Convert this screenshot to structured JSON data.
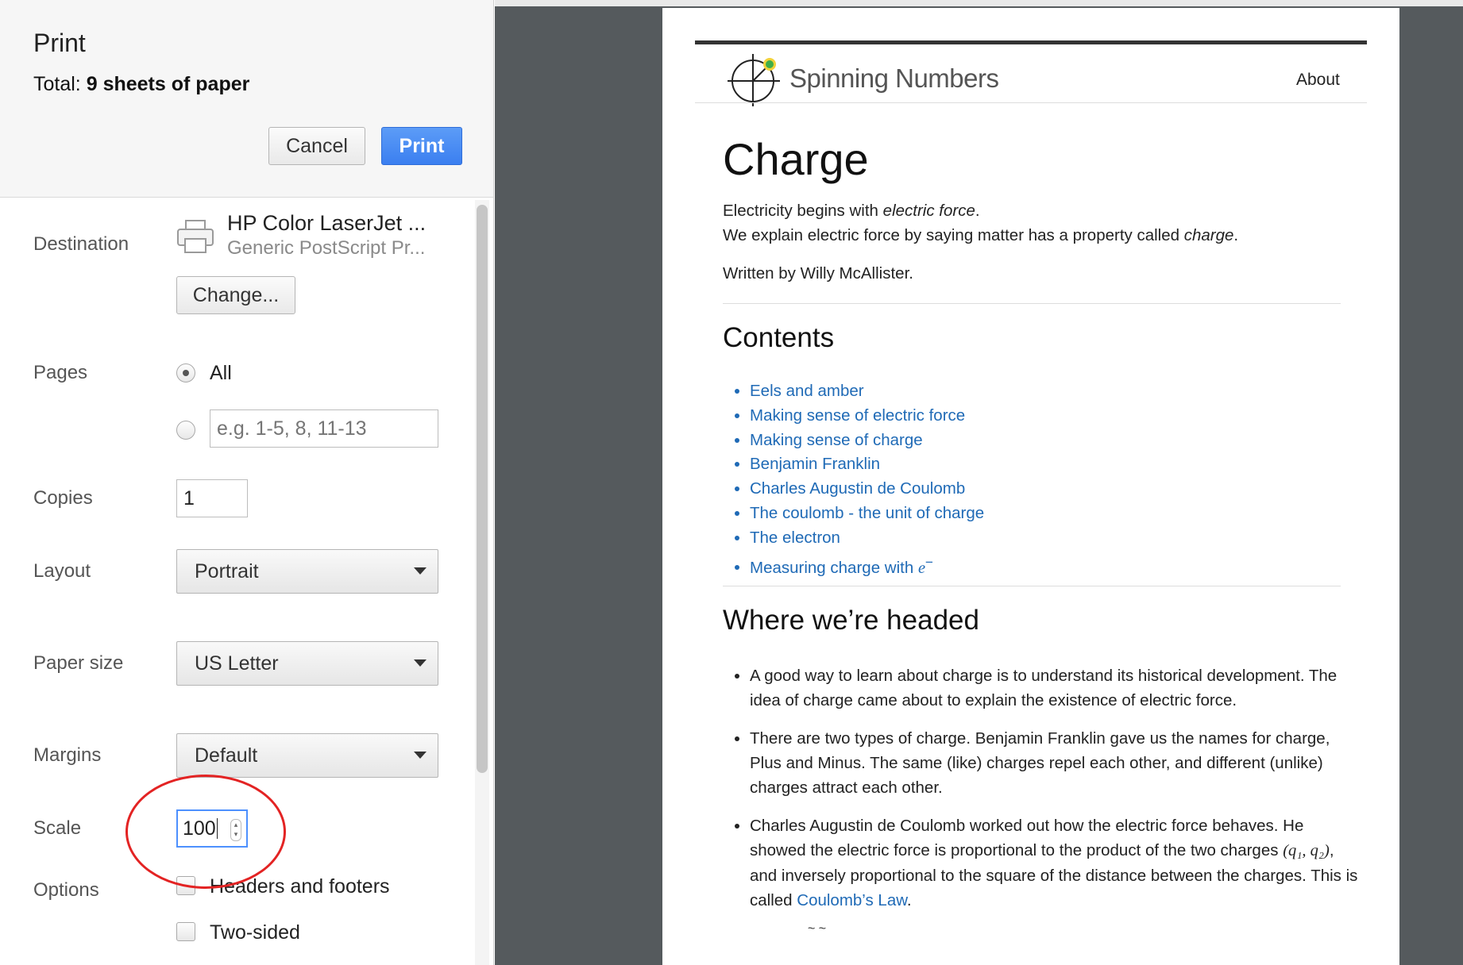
{
  "dialog": {
    "title": "Print",
    "total_prefix": "Total:",
    "total_value": "9 sheets of paper",
    "cancel_label": "Cancel",
    "print_label": "Print"
  },
  "settings": {
    "destination_label": "Destination",
    "destination_name": "HP Color LaserJet ...",
    "destination_sub": "Generic PostScript Pr...",
    "change_label": "Change...",
    "pages_label": "Pages",
    "pages_all": "All",
    "pages_placeholder": "e.g. 1-5, 8, 11-13",
    "copies_label": "Copies",
    "copies_value": "1",
    "layout_label": "Layout",
    "layout_value": "Portrait",
    "paper_label": "Paper size",
    "paper_value": "US Letter",
    "margins_label": "Margins",
    "margins_value": "Default",
    "scale_label": "Scale",
    "scale_value": "100",
    "options_label": "Options",
    "opt_headers": "Headers and footers",
    "opt_twosided": "Two-sided"
  },
  "preview": {
    "brand": "Spinning Numbers",
    "about": "About",
    "title": "Charge",
    "intro1_a": "Electricity begins with ",
    "intro1_em": "electric force",
    "intro1_b": ".",
    "intro2_a": "We explain electric force by saying matter has a property called ",
    "intro2_em": "charge",
    "intro2_b": ".",
    "author": "Written by Willy McAllister.",
    "contents_heading": "Contents",
    "contents": [
      "Eels and amber",
      "Making sense of electric force",
      "Making sense of charge",
      "Benjamin Franklin",
      "Charles Augustin de Coulomb",
      "The coulomb - the unit of charge",
      "The electron",
      "Measuring charge with "
    ],
    "electron_symbol": "e",
    "electron_sup": "−",
    "headed_heading": "Where we’re headed",
    "b1": "A good way to learn about charge is to understand its historical development. The idea of charge came about to explain the existence of electric force.",
    "b2": "There are two types of charge. Benjamin Franklin gave us the names for charge, Plus and Minus. The same (like) charges repel each other, and different (unlike) charges attract each other.",
    "b3_a": "Charles Augustin de Coulomb worked out how the electric force behaves. He showed the electric force is proportional to the product of the two charges ",
    "b3_math": "(q₁, q₂)",
    "b3_b": ", and inversely proportional to the square of the distance between the charges. This is called ",
    "b3_link": "Coulomb’s Law",
    "b3_c": ".",
    "frag": "~ ~"
  },
  "colors": {
    "print_button": "#3b7ff0",
    "link": "#1f6ab6",
    "annotation_circle": "#e32323",
    "preview_bg": "#555a5d"
  }
}
